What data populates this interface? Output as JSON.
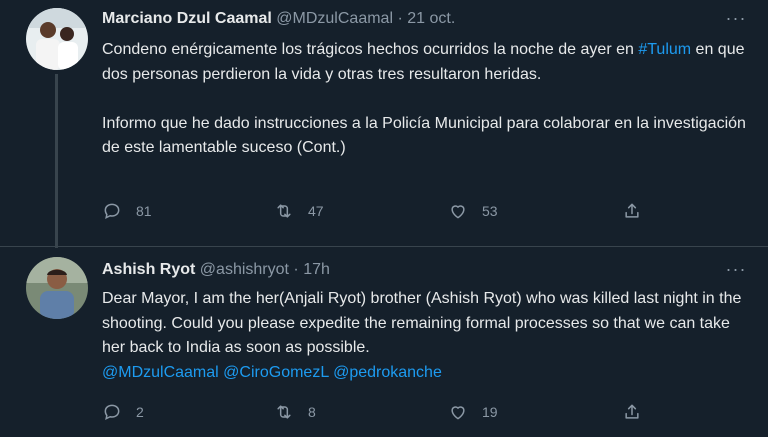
{
  "tweets": [
    {
      "name": "Marciano Dzul Caamal",
      "handle": "@MDzulCaamal",
      "separator": "·",
      "time": "21 oct.",
      "more": "···",
      "body": {
        "p1_a": "Condeno enérgicamente los trágicos hechos ocurridos la noche de ayer en",
        "hashtag": "#Tulum",
        "p1_b": " en que dos personas perdieron la vida y otras tres resultaron heridas.",
        "p2": "Informo que he dado instrucciones a la Policía Municipal para colaborar en la investigación de este lamentable suceso (Cont.)"
      },
      "replies": "81",
      "retweets": "47",
      "likes": "53"
    },
    {
      "name": "Ashish Ryot",
      "handle": "@ashishryot",
      "separator": "·",
      "time": "17h",
      "more": "···",
      "body": {
        "p1": "Dear Mayor, I am the her(Anjali Ryot) brother (Ashish Ryot) who was killed last night in the shooting. Could you please expedite the remaining formal processes so that we can take her back to India as soon as possible.",
        "mention1": "@MDzulCaamal",
        "mention2": "@CiroGomezL",
        "mention3": "@pedrokanche"
      },
      "replies": "2",
      "retweets": "8",
      "likes": "19"
    }
  ],
  "colors": {
    "background": "#15202b",
    "text": "#e7e9ea",
    "muted": "#8b98a5",
    "link": "#1d9bf0",
    "divider": "#38444d"
  }
}
